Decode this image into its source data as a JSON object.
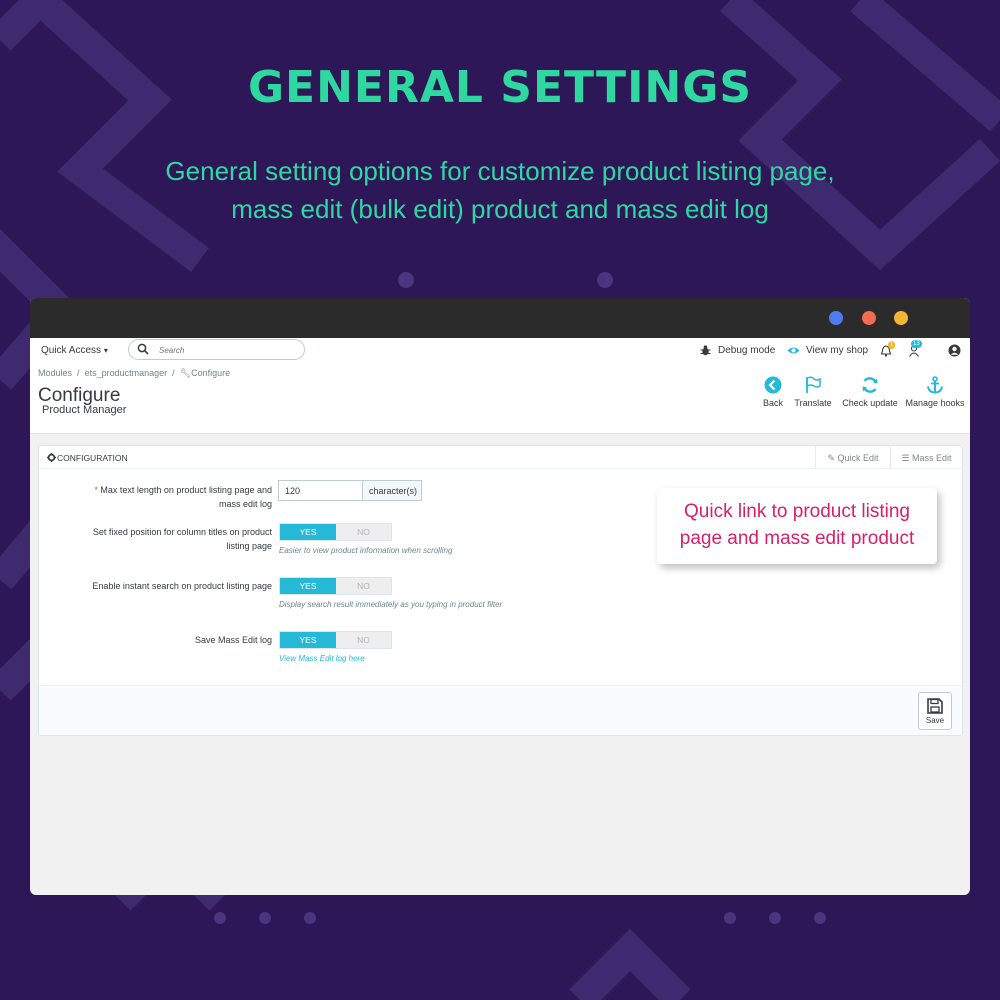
{
  "headline": "GENERAL SETTINGS",
  "subline": {
    "line1": "General setting options for customize product listing page,",
    "line2": "mass edit (bulk edit) product and mass edit log"
  },
  "topbar": {
    "quick_access": "Quick Access",
    "search_placeholder": "Search",
    "debug_mode": "Debug mode",
    "view_my_shop": "View my shop",
    "notifications_count": "1",
    "customers_count": "13"
  },
  "breadcrumb": {
    "modules": "Modules",
    "module": "ets_productmanager",
    "current": "Configure",
    "sep": "/"
  },
  "page": {
    "title": "Configure",
    "subtitle": "Product Manager"
  },
  "toolbar": {
    "back": "Back",
    "translate": "Translate",
    "check_update": "Check update",
    "manage_hooks": "Manage hooks"
  },
  "panel": {
    "title": "CONFIGURATION",
    "quick_edit": "Quick Edit",
    "mass_edit": "Mass Edit",
    "fields": {
      "max_text": {
        "required": "*",
        "label_line1": "Max text length on product listing page and",
        "label_line2": "mass edit log",
        "value": "120",
        "addon": "character(s)"
      },
      "fixed_position": {
        "label_line1": "Set fixed position for column titles on product",
        "label_line2": "listing page",
        "yes": "YES",
        "no": "NO",
        "help": "Easier to view product information when scrolling"
      },
      "instant_search": {
        "label": "Enable instant search on product listing page",
        "yes": "YES",
        "no": "NO",
        "help": "Display search result immediately as you typing in product filter"
      },
      "save_log": {
        "label": "Save Mass Edit log",
        "yes": "YES",
        "no": "NO",
        "link": "View Mass Edit log here"
      }
    },
    "save": "Save"
  },
  "callout": {
    "line1": "Quick link to product listing",
    "line2": "page and mass edit product"
  },
  "colors": {
    "background": "#2d1757",
    "accent_green": "#2fd8a0",
    "toggle_on": "#25b9d7",
    "callout_text": "#d6206b"
  }
}
